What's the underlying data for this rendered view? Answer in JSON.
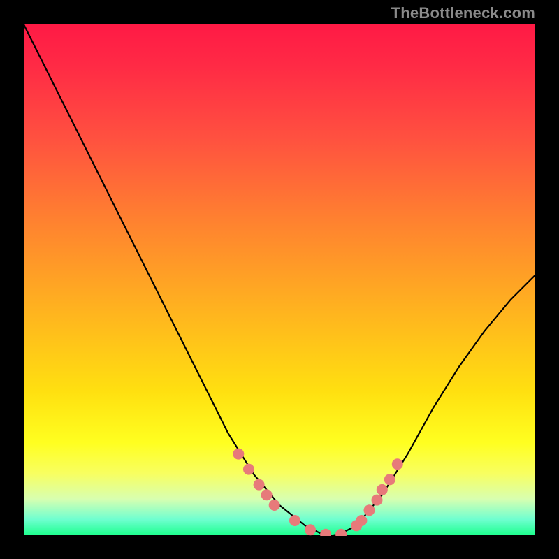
{
  "watermark": "TheBottleneck.com",
  "chart_data": {
    "type": "line",
    "title": "",
    "xlabel": "",
    "ylabel": "",
    "xlim": [
      0,
      100
    ],
    "ylim": [
      0,
      100
    ],
    "grid": false,
    "legend": false,
    "background": "heatmap-gradient-red-to-green",
    "series": [
      {
        "name": "bottleneck-curve",
        "x": [
          0,
          5,
          10,
          15,
          20,
          25,
          30,
          35,
          40,
          45,
          50,
          55,
          58,
          60,
          62,
          65,
          70,
          75,
          80,
          85,
          90,
          95,
          100
        ],
        "y": [
          100,
          90,
          80,
          70,
          60,
          50,
          40,
          30,
          20,
          12,
          6,
          2,
          0.5,
          0,
          0.5,
          2,
          8,
          16,
          25,
          33,
          40,
          46,
          51
        ]
      }
    ],
    "markers": {
      "name": "highlighted-range",
      "x": [
        42,
        44,
        46,
        47.5,
        49,
        53,
        56,
        59,
        62,
        65,
        66,
        67.5,
        69,
        70,
        71.5,
        73
      ],
      "y": [
        16,
        13,
        10,
        8,
        6,
        3,
        1.2,
        0.3,
        0.3,
        2,
        3,
        5,
        7,
        9,
        11,
        14
      ]
    }
  }
}
